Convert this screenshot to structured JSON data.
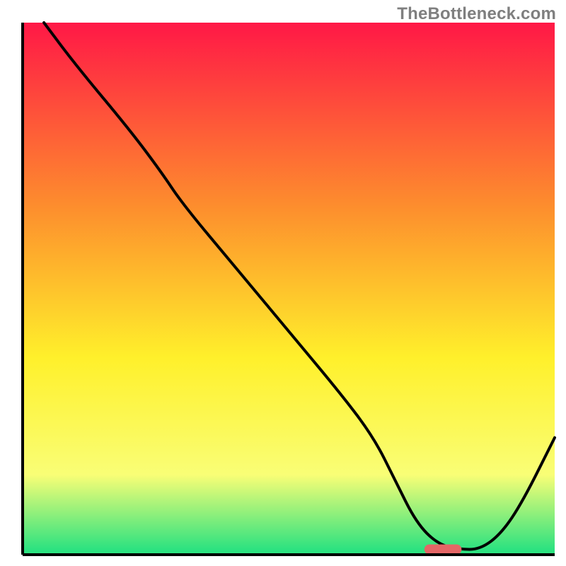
{
  "watermark": "TheBottleneck.com",
  "chart_data": {
    "type": "line",
    "title": "",
    "xlabel": "",
    "ylabel": "",
    "xlim": [
      0,
      100
    ],
    "ylim": [
      0,
      100
    ],
    "grid": false,
    "legend": false,
    "x": [
      4,
      10,
      20,
      26,
      30,
      40,
      50,
      60,
      66,
      70,
      74,
      78,
      82,
      86,
      90,
      94,
      100
    ],
    "values": [
      100,
      92,
      80,
      72,
      66,
      54,
      42,
      30,
      22,
      14,
      6,
      2,
      1,
      1,
      4,
      10,
      22
    ],
    "gradient_background": {
      "top_color": "#ff1846",
      "mid_upper_color": "#fd8f2d",
      "mid_color": "#fff02b",
      "mid_lower_color": "#f9fe76",
      "bottom_color": "#2de280"
    },
    "marker": {
      "x_center": 79,
      "width": 7,
      "y": 1,
      "color": "#e46666"
    },
    "axis_line_color": "#000000",
    "curve_color": "#000000"
  }
}
